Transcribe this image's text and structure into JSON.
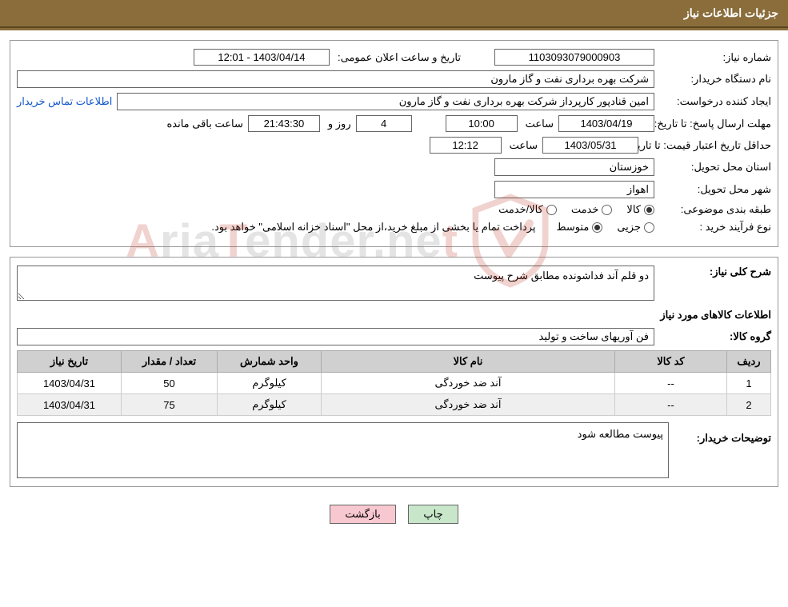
{
  "header": {
    "title": "جزئیات اطلاعات نیاز"
  },
  "fields": {
    "need_no_label": "شماره نیاز:",
    "need_no": "1103093079000903",
    "announce_label": "تاریخ و ساعت اعلان عمومی:",
    "announce_value": "1403/04/14 - 12:01",
    "buyer_org_label": "نام دستگاه خریدار:",
    "buyer_org": "شرکت بهره برداری نفت و گاز مارون",
    "requester_label": "ایجاد کننده درخواست:",
    "requester": "امین قنادپور کارپرداز شرکت بهره برداری نفت و گاز مارون",
    "contact_link": "اطلاعات تماس خریدار",
    "deadline_label": "مهلت ارسال پاسخ: تا تاریخ:",
    "deadline_date": "1403/04/19",
    "time_label": "ساعت",
    "deadline_time": "10:00",
    "days_val": "4",
    "days_and": "روز و",
    "countdown": "21:43:30",
    "remain": "ساعت باقی مانده",
    "validity_label": "حداقل تاریخ اعتبار قیمت: تا تاریخ:",
    "validity_date": "1403/05/31",
    "validity_time": "12:12",
    "province_label": "استان محل تحویل:",
    "province": "خوزستان",
    "city_label": "شهر محل تحویل:",
    "city": "اهواز",
    "subject_class_label": "طبقه بندی موضوعی:",
    "subject_class_opt1": "کالا",
    "subject_class_opt2": "خدمت",
    "subject_class_opt3": "کالا/خدمت",
    "purchase_type_label": "نوع فرآیند خرید :",
    "purchase_type_opt1": "جزیی",
    "purchase_type_opt2": "متوسط",
    "purchase_note": "پرداخت تمام یا بخشی از مبلغ خرید،از محل \"اسناد خزانه اسلامی\" خواهد بود."
  },
  "section2": {
    "overall_label": "شرح کلی نیاز:",
    "overall_desc": "دو قلم آند فداشونده مطابق شرح پیوست",
    "items_info_label": "اطلاعات کالاهای مورد نیاز",
    "group_label": "گروه کالا:",
    "group_value": "فن آوریهای ساخت و تولید",
    "columns": {
      "row": "ردیف",
      "code": "کد کالا",
      "name": "نام کالا",
      "unit": "واحد شمارش",
      "qty": "تعداد / مقدار",
      "date": "تاریخ نیاز"
    },
    "rows": [
      {
        "row": "1",
        "code": "--",
        "name": "آند ضد خوردگی",
        "unit": "کیلوگرم",
        "qty": "50",
        "date": "1403/04/31"
      },
      {
        "row": "2",
        "code": "--",
        "name": "آند ضد خوردگی",
        "unit": "کیلوگرم",
        "qty": "75",
        "date": "1403/04/31"
      }
    ],
    "buyer_desc_label": "توضیحات خریدار:",
    "buyer_desc": "پیوست مطالعه شود"
  },
  "buttons": {
    "print": "چاپ",
    "back": "بازگشت"
  }
}
